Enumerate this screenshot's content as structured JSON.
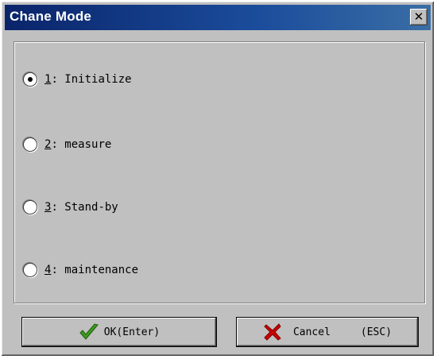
{
  "window": {
    "title": "Chane Mode",
    "close_label": "✕"
  },
  "options": [
    {
      "key": "1",
      "rest": ": Initialize",
      "selected": true
    },
    {
      "key": "2",
      "rest": ": measure",
      "selected": false
    },
    {
      "key": "3",
      "rest": ": Stand-by",
      "selected": false
    },
    {
      "key": "4",
      "rest": ": maintenance",
      "selected": false
    }
  ],
  "buttons": {
    "ok_label": "OK(Enter)",
    "cancel_label": "Cancel",
    "cancel_key": "(ESC)"
  },
  "icons": {
    "ok": "checkmark-icon",
    "cancel": "red-x-icon"
  },
  "colors": {
    "titlebar": "#0a246a",
    "checkmark": "#3c9a1e",
    "cancel_x": "#cc0000",
    "face": "#c0c0c0"
  }
}
